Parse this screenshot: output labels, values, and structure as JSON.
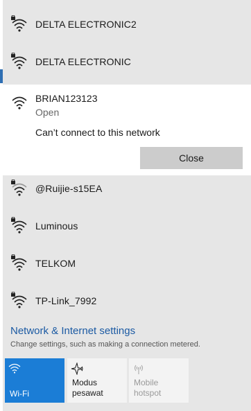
{
  "networks_above": [
    {
      "name": "DELTA ELECTRONIC2",
      "secured": true
    },
    {
      "name": "DELTA ELECTRONIC",
      "secured": true
    }
  ],
  "expanded_network": {
    "name": "BRIAN123123",
    "security": "Open",
    "message": "Can’t connect to this network",
    "close_label": "Close"
  },
  "networks_below": [
    {
      "name": "@Ruijie-s15EA",
      "secured": true
    },
    {
      "name": "Luminous",
      "secured": true
    },
    {
      "name": "TELKOM",
      "secured": true
    },
    {
      "name": "TP-Link_7992",
      "secured": true
    }
  ],
  "settings": {
    "link": "Network & Internet settings",
    "description": "Change settings, such as making a connection metered."
  },
  "quick_actions": [
    {
      "label": "Wi-Fi",
      "icon": "wifi-icon",
      "state": "on"
    },
    {
      "label_line1": "Modus",
      "label_line2": "pesawat",
      "icon": "airplane-icon",
      "state": "off"
    },
    {
      "label_line1": "Mobile",
      "label_line2": "hotspot",
      "icon": "hotspot-icon",
      "state": "disabled"
    }
  ],
  "colors": {
    "flyout_bg": "#e6e6e6",
    "accent": "#1b7dd6",
    "link": "#1b5aa3"
  }
}
